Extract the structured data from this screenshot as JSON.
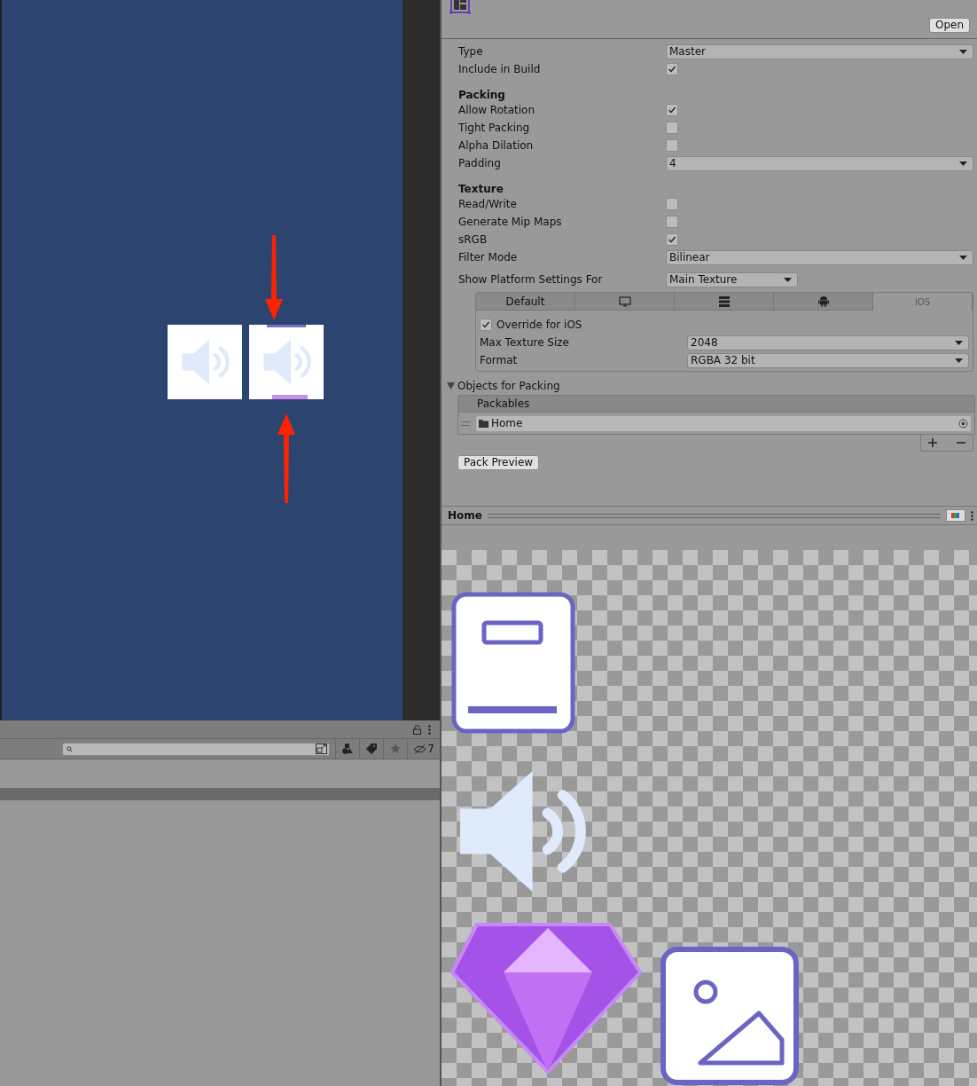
{
  "inspector": {
    "open_button": "Open",
    "properties": [
      {
        "kind": "dropdown",
        "label": "Type",
        "value": "Master"
      },
      {
        "kind": "checkbox",
        "label": "Include in Build",
        "checked": true
      },
      {
        "kind": "header",
        "label": "Packing"
      },
      {
        "kind": "checkbox",
        "label": "Allow Rotation",
        "checked": true
      },
      {
        "kind": "checkbox",
        "label": "Tight Packing",
        "checked": false
      },
      {
        "kind": "checkbox",
        "label": "Alpha Dilation",
        "checked": false
      },
      {
        "kind": "dropdown",
        "label": "Padding",
        "value": "4"
      },
      {
        "kind": "header",
        "label": "Texture"
      },
      {
        "kind": "checkbox",
        "label": "Read/Write",
        "checked": false
      },
      {
        "kind": "checkbox",
        "label": "Generate Mip Maps",
        "checked": false
      },
      {
        "kind": "checkbox",
        "label": "sRGB",
        "checked": true
      },
      {
        "kind": "dropdown",
        "label": "Filter Mode",
        "value": "Bilinear"
      }
    ],
    "platform_settings": {
      "label": "Show Platform Settings For",
      "value": "Main Texture",
      "tabs": [
        {
          "kind": "text",
          "label": "Default",
          "selected": false
        },
        {
          "kind": "monitor",
          "selected": false
        },
        {
          "kind": "server",
          "selected": false
        },
        {
          "kind": "android",
          "selected": false
        },
        {
          "kind": "text",
          "label": "iOS",
          "selected": true
        }
      ],
      "override": {
        "label": "Override for iOS",
        "checked": true
      },
      "fields": [
        {
          "label": "Max Texture Size",
          "value": "2048"
        },
        {
          "label": "Format",
          "value": "RGBA 32 bit"
        }
      ]
    },
    "objects_for_packing": {
      "label": "Objects for Packing",
      "expanded": true,
      "list_header": "Packables",
      "items": [
        {
          "name": "Home"
        }
      ]
    },
    "pack_preview_button": "Pack Preview",
    "preview": {
      "title": "Home"
    }
  },
  "project": {
    "hidden_count": "7"
  }
}
